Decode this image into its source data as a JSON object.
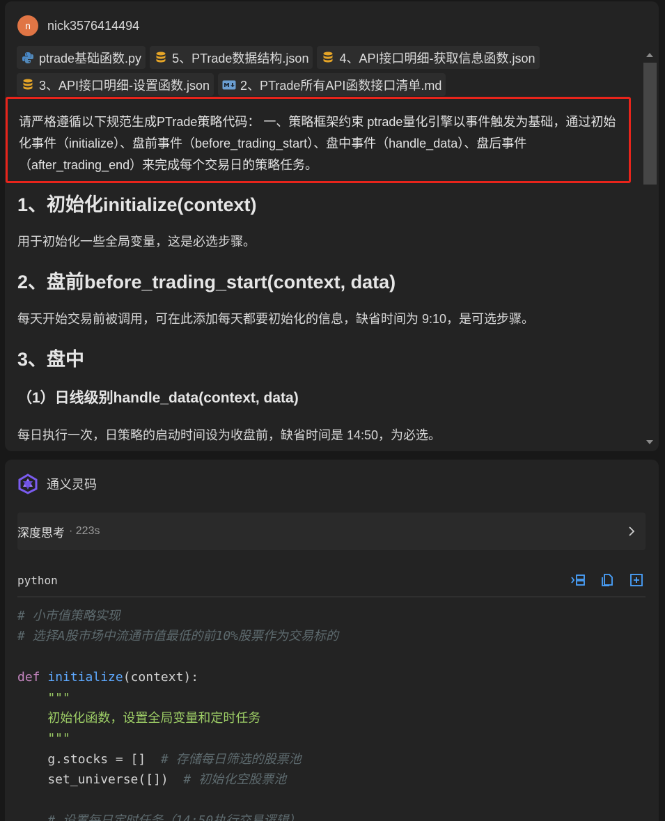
{
  "user": {
    "avatar_letter": "n",
    "name": "nick3576414494"
  },
  "attachments": [
    {
      "name": "ptrade基础函数.py",
      "icon": "python-icon"
    },
    {
      "name": "5、PTrade数据结构.json",
      "icon": "json-database-icon"
    },
    {
      "name": "4、API接口明细-获取信息函数.json",
      "icon": "json-database-icon"
    },
    {
      "name": "3、API接口明细-设置函数.json",
      "icon": "json-database-icon"
    },
    {
      "name": "2、PTrade所有API函数接口清单.md",
      "icon": "markdown-icon"
    }
  ],
  "prompt": {
    "text": "请严格遵循以下规范生成PTrade策略代码： 一、策略框架约束 ptrade量化引擎以事件触发为基础，通过初始化事件（initialize）、盘前事件（before_trading_start）、盘中事件（handle_data）、盘后事件（after_trading_end）来完成每个交易日的策略任务。",
    "highlight_color": "#e8241b"
  },
  "content": {
    "h1_initialize": "1、初始化initialize(context)",
    "p_initialize": "用于初始化一些全局变量，这是必选步骤。",
    "h1_before": "2、盘前before_trading_start(context, data)",
    "p_before": "每天开始交易前被调用，可在此添加每天都要初始化的信息，缺省时间为 9:10，是可选步骤。",
    "h1_intraday": "3、盘中",
    "h2_daily": "（1）日线级别handle_data(context, data)",
    "p_daily": "每日执行一次，日策略的启动时间设为收盘前，缺省时间是 14:50，为必选。"
  },
  "assistant": {
    "name": "通义灵码",
    "thinking_label": "深度思考",
    "thinking_time": "· 223s"
  },
  "code_block": {
    "language": "python",
    "lines": {
      "l1": "# 小市值策略实现",
      "l2": "# 选择A股市场中流通市值最低的前10%股票作为交易标的",
      "l4_kw": "def",
      "l4_fn": "initialize",
      "l4_rest": "(context):",
      "l5": "    \"\"\"",
      "l6": "    初始化函数，设置全局变量和定时任务",
      "l7": "    \"\"\"",
      "l8_code": "    g.stocks = []",
      "l8_com": "  # 存储每日筛选的股票池",
      "l9_code": "    set_universe([])",
      "l9_com": "  # 初始化空股票池",
      "l11": "    # 设置每日定时任务（14:50执行交易逻辑）"
    }
  }
}
